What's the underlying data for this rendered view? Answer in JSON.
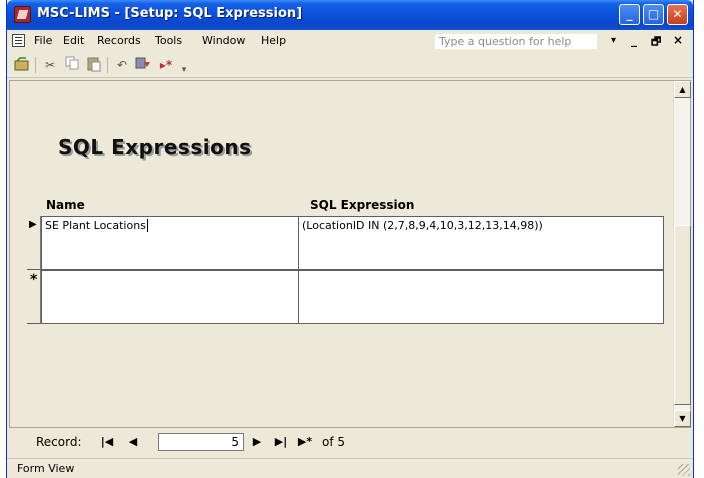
{
  "window": {
    "title": "MSC-LIMS - [Setup: SQL Expression]",
    "icon": "msaccess-form-icon",
    "controls": {
      "minimize": "_",
      "maximize": "□",
      "close": "✕"
    }
  },
  "menubar": {
    "items": [
      "File",
      "Edit",
      "Records",
      "Tools",
      "Window",
      "Help"
    ],
    "help_placeholder": "Type a question for help",
    "mdi_controls": {
      "dropdown": "▾",
      "minimize": "_",
      "restore": "🗗",
      "close": "×"
    }
  },
  "toolbar": {
    "icons": [
      "view-form-icon",
      "cut-icon",
      "copy-icon",
      "paste-icon",
      "undo-icon",
      "filter-icon",
      "new-record-icon",
      "more-icon"
    ]
  },
  "form": {
    "title": "SQL Expressions",
    "columns": {
      "name": "Name",
      "expression": "SQL Expression"
    },
    "rows": [
      {
        "name": "SE Plant Locations",
        "expression": "(LocationID IN (2,7,8,9,4,10,3,12,13,14,98))",
        "selector": "▶"
      },
      {
        "name": "",
        "expression": "",
        "selector": "*"
      }
    ]
  },
  "record_nav": {
    "label": "Record:",
    "current": "5",
    "total_label": "of 5",
    "buttons": {
      "first": "|◀",
      "prev": "◀",
      "next": "▶",
      "last": "▶|",
      "new": "▶*"
    }
  },
  "status": {
    "text": "Form View"
  }
}
